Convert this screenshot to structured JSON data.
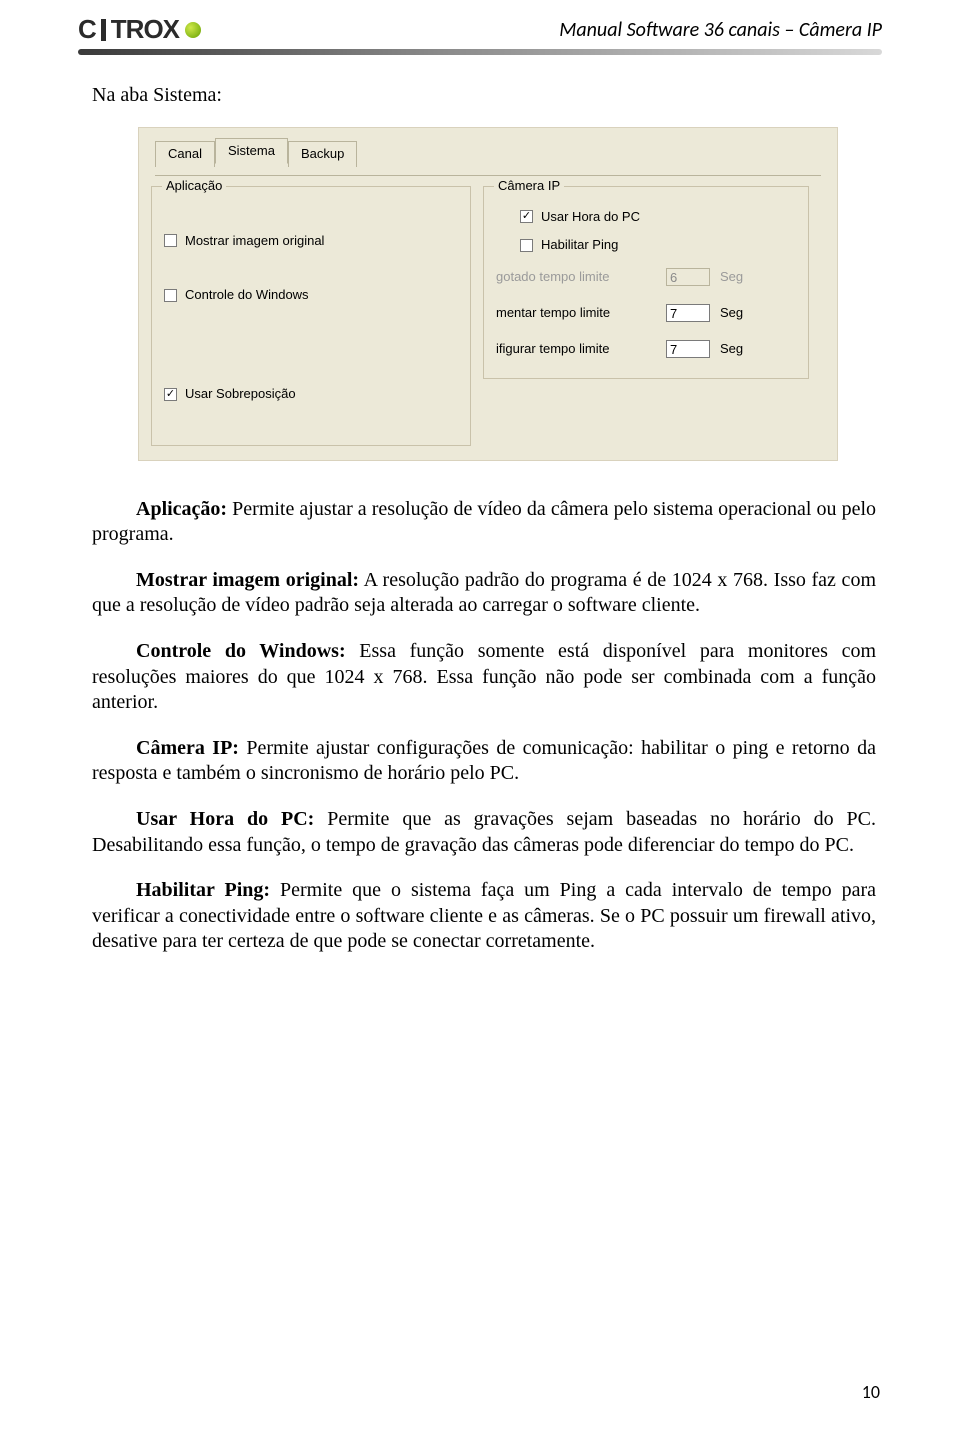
{
  "header": {
    "logo_text_left": "C",
    "logo_text_right": "TROX",
    "doc_title": "Manual Software 36 canais – Câmera IP"
  },
  "section_heading": "Na aba Sistema:",
  "app": {
    "tabs": {
      "canal": "Canal",
      "sistema": "Sistema",
      "backup": "Backup"
    },
    "group_aplicacao": {
      "legend": "Aplicação",
      "mostrar_label": "Mostrar imagem original",
      "controle_label": "Controle do Windows",
      "sobre_label": "Usar Sobreposição"
    },
    "group_camera": {
      "legend": "Câmera IP",
      "usar_hora_label": "Usar Hora do PC",
      "hab_ping_label": "Habilitar Ping",
      "row1_label": "gotado tempo limite",
      "row1_value": "6",
      "row2_label": "mentar tempo limite",
      "row2_value": "7",
      "row3_label": "ifigurar tempo limite",
      "row3_value": "7",
      "unit": "Seg"
    }
  },
  "paragraphs": {
    "p1_b": "Aplicação:",
    "p1_rest": " Permite ajustar a resolução de vídeo da câmera pelo sistema operacional ou pelo programa.",
    "p2_b": "Mostrar imagem original:",
    "p2_rest": " A resolução padrão do programa é de 1024 x 768. Isso faz com que a resolução de vídeo padrão seja alterada ao carregar  o software cliente.",
    "p3_b": "Controle do Windows:",
    "p3_rest": " Essa função somente está disponível para monitores com resoluções maiores do que 1024 x 768. Essa função não pode ser combinada com a função anterior.",
    "p4_b": "Câmera IP:",
    "p4_rest": " Permite ajustar configurações de comunicação: habilitar o ping e retorno da resposta e também o sincronismo de horário pelo PC.",
    "p5_b": "Usar Hora do PC:",
    "p5_rest": " Permite que as gravações sejam baseadas no horário do PC. Desabilitando essa função, o tempo de gravação das câmeras pode diferenciar do tempo do PC.",
    "p6_b": "Habilitar Ping:",
    "p6_rest": " Permite que o sistema faça um Ping a cada intervalo de tempo para verificar a conectividade entre o software cliente e as câmeras. Se o PC possuir um firewall ativo, desative para ter certeza de que pode se conectar corretamente."
  },
  "page_number": "10"
}
